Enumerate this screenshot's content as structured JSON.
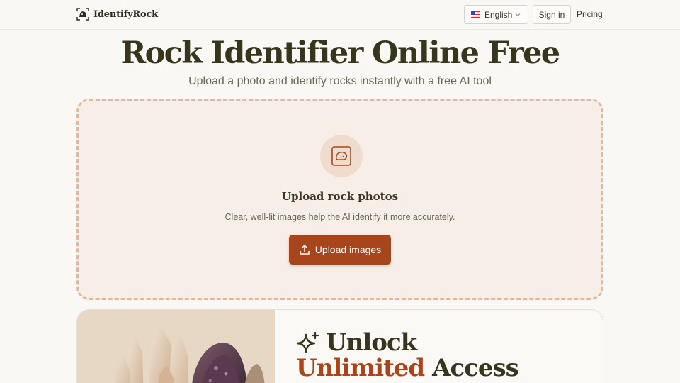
{
  "header": {
    "brand": "IdentifyRock",
    "language": {
      "label": "English",
      "flag": "us-flag-icon"
    },
    "signin_label": "Sign in",
    "pricing_label": "Pricing"
  },
  "hero": {
    "title": "Rock Identifier Online Free",
    "subtitle": "Upload a photo and identify rocks instantly with a free AI tool"
  },
  "upload": {
    "icon": "rock-image-icon",
    "heading": "Upload rock photos",
    "hint": "Clear, well-lit images help the AI identify it more accurately.",
    "button_label": "Upload images",
    "button_icon": "upload-icon"
  },
  "promo": {
    "icon": "sparkle-icon",
    "word1": "Unlock",
    "accent_word": "Unlimited",
    "word2": "Access"
  },
  "colors": {
    "accent": "#a7461c",
    "background": "#faf8f4",
    "upload_bg": "#f7eee7",
    "upload_border": "#dfb9a0",
    "text_dark": "#38351f"
  }
}
